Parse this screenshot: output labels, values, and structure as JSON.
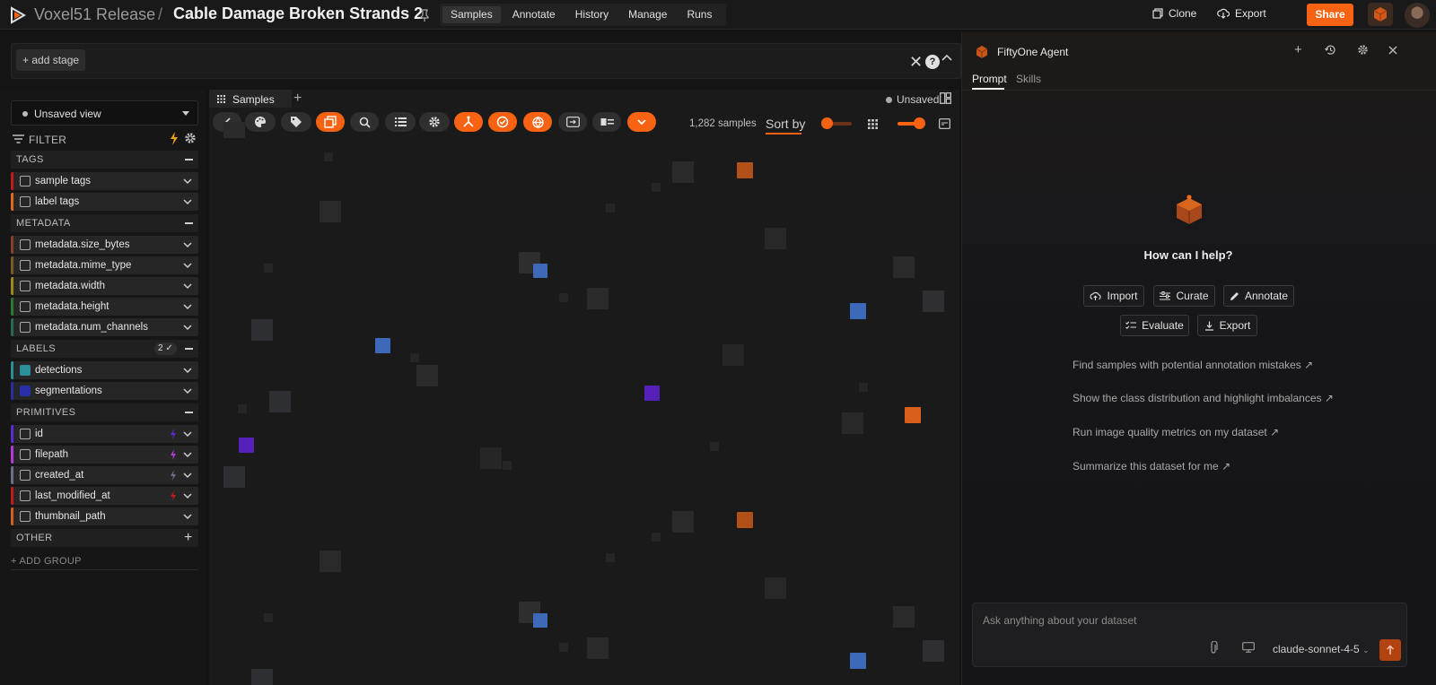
{
  "topbar": {
    "org": "Voxel51 Release",
    "separator": "/",
    "dataset": "Cable Damage Broken Strands 2",
    "tabs": [
      "Samples",
      "Annotate",
      "History",
      "Manage",
      "Runs"
    ],
    "active_tab": "Samples",
    "clone_label": "Clone",
    "export_label": "Export",
    "share_label": "Share"
  },
  "viewbar": {
    "add_stage_label": "+ add stage"
  },
  "sidebar": {
    "view_select": "Unsaved view",
    "filter_label": "FILTER",
    "groups": {
      "tags": "TAGS",
      "metadata": "METADATA",
      "labels": "LABELS",
      "labels_badge": "2",
      "primitives": "PRIMITIVES",
      "other": "OTHER"
    },
    "tag_fields": [
      "sample tags",
      "label tags"
    ],
    "metadata_fields": [
      "metadata.size_bytes",
      "metadata.mime_type",
      "metadata.width",
      "metadata.height",
      "metadata.num_channels"
    ],
    "label_fields": [
      "detections",
      "segmentations"
    ],
    "primitive_fields": [
      "id",
      "filepath",
      "created_at",
      "last_modified_at",
      "thumbnail_path"
    ],
    "add_group_label": "+ ADD GROUP",
    "colors": {
      "tags": [
        "#c4191b",
        "#e2691a"
      ],
      "metadata": [
        "#8a3f26",
        "#7a5a2a",
        "#9c8a1c",
        "#2b7a2e",
        "#2a6a52"
      ],
      "labels": [
        "#2a8f98",
        "#2a2fa8"
      ],
      "primitives": [
        "#5b2bd4",
        "#b33ad6",
        "#6a6f86",
        "#c21b1b",
        "#d1611a"
      ]
    }
  },
  "grid": {
    "tab_label": "Samples",
    "unsaved_label": "Unsaved",
    "sample_count": "1,282 samples",
    "sort_label": "Sort by",
    "accent": "#f86313"
  },
  "agent": {
    "title": "FiftyOne Agent",
    "tabs": [
      "Prompt",
      "Skills"
    ],
    "help_title": "How can I help?",
    "quick_actions": [
      "Import",
      "Curate",
      "Annotate",
      "Evaluate",
      "Export"
    ],
    "suggestions": [
      "Find samples with potential annotation mistakes",
      "Show the class distribution and highlight imbalances",
      "Run image quality metrics on my dataset",
      "Summarize this dataset for me"
    ],
    "input_placeholder": "Ask anything about your dataset",
    "model": "claude-sonnet-4-5"
  }
}
